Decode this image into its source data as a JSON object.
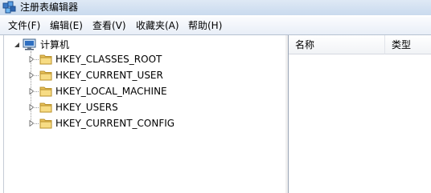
{
  "window": {
    "title": "注册表编辑器"
  },
  "menu": [
    {
      "label": "文件(F)"
    },
    {
      "label": "编辑(E)"
    },
    {
      "label": "查看(V)"
    },
    {
      "label": "收藏夹(A)"
    },
    {
      "label": "帮助(H)"
    }
  ],
  "tree": {
    "root": {
      "label": "计算机",
      "icon": "computer-icon"
    },
    "keys": [
      {
        "label": "HKEY_CLASSES_ROOT"
      },
      {
        "label": "HKEY_CURRENT_USER"
      },
      {
        "label": "HKEY_LOCAL_MACHINE"
      },
      {
        "label": "HKEY_USERS"
      },
      {
        "label": "HKEY_CURRENT_CONFIG"
      }
    ]
  },
  "list": {
    "columns": [
      {
        "label": "名称"
      },
      {
        "label": "类型"
      }
    ]
  }
}
